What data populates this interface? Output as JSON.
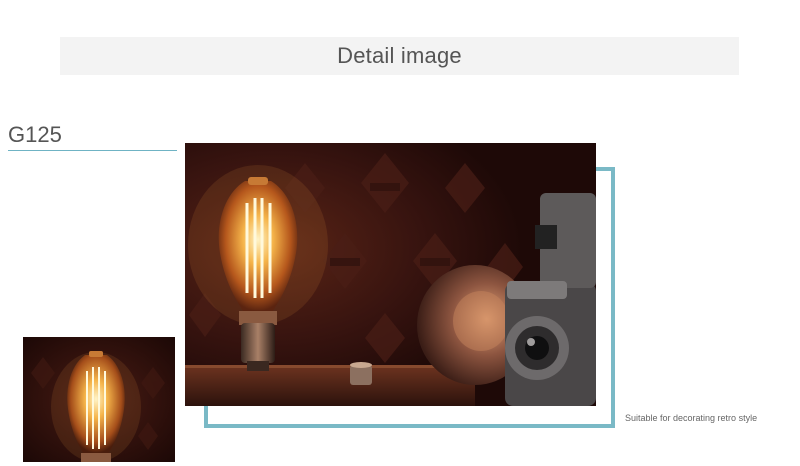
{
  "header": {
    "title": "Detail image"
  },
  "product": {
    "model": "G125",
    "caption": "Suitable for decorating retro style"
  },
  "colors": {
    "accent": "#7ab9c6",
    "banner_bg": "#f3f3f3",
    "text": "#555555"
  },
  "images": {
    "main": "vintage-edison-bulb-with-camera-photo",
    "thumbnail": "edison-bulb-thumbnail-photo"
  }
}
